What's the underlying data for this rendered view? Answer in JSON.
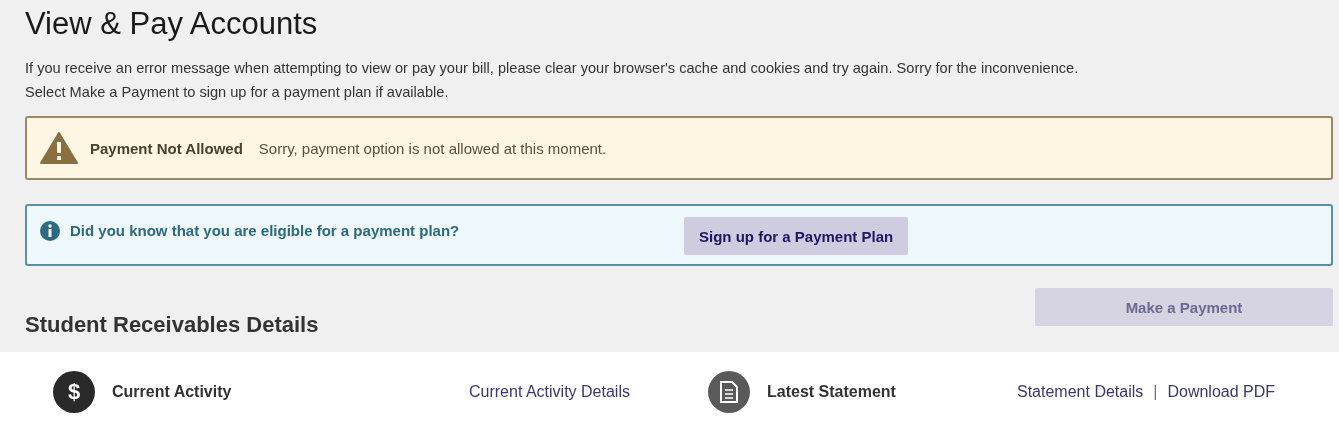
{
  "page_title": "View & Pay Accounts",
  "intro": [
    "If you receive an error message when attempting to view or pay your bill, please clear your browser's cache and cookies and try again. Sorry for the inconvenience.",
    "Select Make a Payment to sign up for a payment plan if available."
  ],
  "alert": {
    "kind": "warning",
    "title": "Payment Not Allowed",
    "message": "Sorry, payment option is not allowed at this moment."
  },
  "info": {
    "kind": "info",
    "message": "Did you know that you are eligible for a payment plan?",
    "button": "Sign up for a Payment Plan"
  },
  "make_payment_button": {
    "label": "Make a Payment",
    "disabled": true
  },
  "section_title": "Student Receivables Details",
  "panels": [
    {
      "kind": "dollar",
      "icon_text": "$",
      "label": "Current Activity",
      "links": [
        "Current Activity Details"
      ]
    },
    {
      "kind": "document",
      "label": "Latest Statement",
      "links": [
        "Statement Details",
        "Download PDF"
      ],
      "separator": "|"
    }
  ]
}
